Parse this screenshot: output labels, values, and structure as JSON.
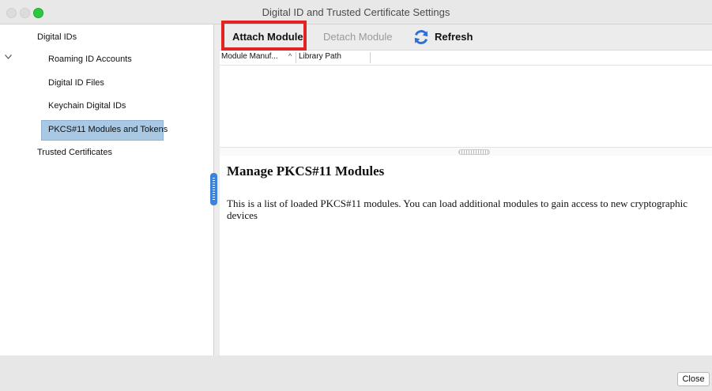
{
  "window": {
    "title": "Digital ID and Trusted Certificate Settings"
  },
  "sidebar": {
    "root_label": "Digital IDs",
    "items": [
      {
        "label": "Roaming ID Accounts"
      },
      {
        "label": "Digital ID Files"
      },
      {
        "label": "Keychain Digital IDs"
      },
      {
        "label": "PKCS#11 Modules and Tokens",
        "selected": true
      }
    ],
    "trusted_label": "Trusted Certificates"
  },
  "toolbar": {
    "attach_label": "Attach Module",
    "detach_label": "Detach Module",
    "refresh_label": "Refresh"
  },
  "table": {
    "columns": [
      "Module Manuf...",
      "Library Path"
    ],
    "sort_indicator": "^",
    "rows": []
  },
  "info": {
    "title": "Manage PKCS#11 Modules",
    "body": "This is a list of loaded PKCS#11 modules. You can load additional modules to gain access to new cryptographic devices"
  },
  "footer": {
    "close_label": "Close"
  },
  "colors": {
    "selection": "#a8c8e4",
    "highlight_box": "#e32222",
    "splitter": "#3b82d8",
    "max_button": "#2bc840"
  },
  "icons": [
    "chevron-down-icon",
    "refresh-icon"
  ]
}
